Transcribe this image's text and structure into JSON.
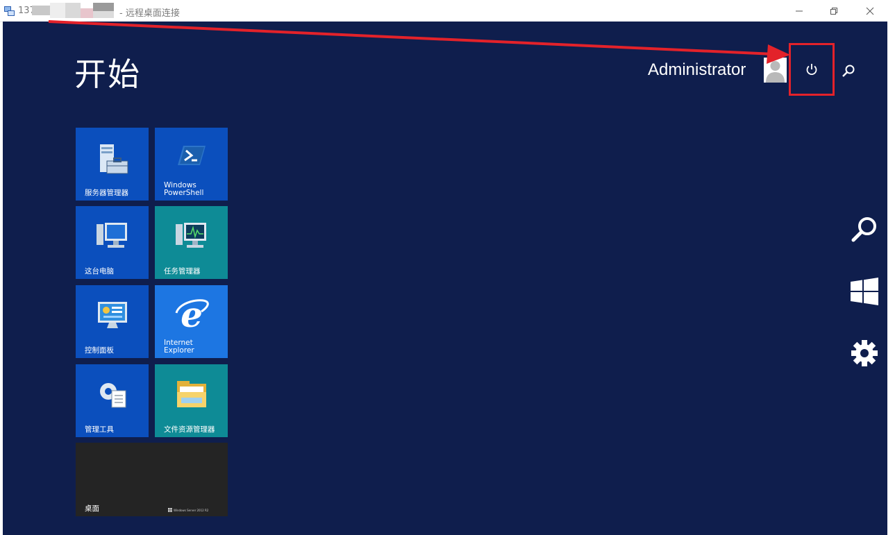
{
  "window": {
    "title_prefix": "137",
    "title_suffix": "- 远程桌面连接",
    "controls": [
      "minimize",
      "restore",
      "close"
    ]
  },
  "start": {
    "title": "开始",
    "user": "Administrator",
    "power_icon": "power-icon",
    "search_icon": "search-icon"
  },
  "tiles": [
    {
      "label": "服务器管理器",
      "icon": "server-manager-icon",
      "color": "#0b4fbd"
    },
    {
      "label": "Windows\nPowerShell",
      "icon": "powershell-icon",
      "color": "#0b4fbd"
    },
    {
      "label": "这台电脑",
      "icon": "computer-icon",
      "color": "#0b4fbd"
    },
    {
      "label": "任务管理器",
      "icon": "task-manager-icon",
      "color": "#0e8b96"
    },
    {
      "label": "控制面板",
      "icon": "control-panel-icon",
      "color": "#0b4fbd"
    },
    {
      "label": "Internet\nExplorer",
      "icon": "internet-explorer-icon",
      "color": "#1d76e2"
    },
    {
      "label": "管理工具",
      "icon": "admin-tools-icon",
      "color": "#0b4fbd"
    },
    {
      "label": "文件资源管理器",
      "icon": "file-explorer-icon",
      "color": "#0e8b96"
    },
    {
      "label": "桌面",
      "icon": "desktop-icon",
      "color": "#242424",
      "caption": "Windows Server 2012 R2"
    }
  ],
  "charms": [
    "search-icon",
    "windows-start-icon",
    "settings-gear-icon"
  ],
  "colors": {
    "background": "#0f1e4d",
    "highlight": "#e3222a"
  }
}
